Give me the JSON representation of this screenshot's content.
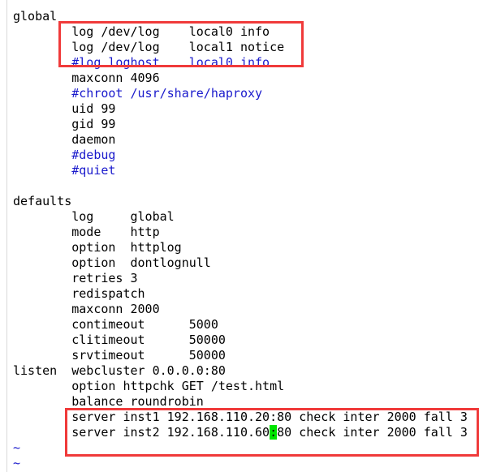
{
  "colors": {
    "comment": "#1a1acc",
    "highlight_box": "#f03a3a",
    "cursor": "#00e600"
  },
  "lines": [
    {
      "text": "global",
      "type": "normal"
    },
    {
      "text": "        log /dev/log    local0 info",
      "type": "normal"
    },
    {
      "text": "        log /dev/log    local1 notice",
      "type": "normal"
    },
    {
      "text": "        #log loghost    local0 info",
      "type": "comment"
    },
    {
      "text": "        maxconn 4096",
      "type": "normal"
    },
    {
      "text": "        #chroot /usr/share/haproxy",
      "type": "comment"
    },
    {
      "text": "        uid 99",
      "type": "normal"
    },
    {
      "text": "        gid 99",
      "type": "normal"
    },
    {
      "text": "        daemon",
      "type": "normal"
    },
    {
      "text": "        #debug",
      "type": "comment"
    },
    {
      "text": "        #quiet",
      "type": "comment"
    },
    {
      "text": "",
      "type": "normal"
    },
    {
      "text": "defaults",
      "type": "normal"
    },
    {
      "text": "        log     global",
      "type": "normal"
    },
    {
      "text": "        mode    http",
      "type": "normal"
    },
    {
      "text": "        option  httplog",
      "type": "normal"
    },
    {
      "text": "        option  dontlognull",
      "type": "normal"
    },
    {
      "text": "        retries 3",
      "type": "normal"
    },
    {
      "text": "        redispatch",
      "type": "normal"
    },
    {
      "text": "        maxconn 2000",
      "type": "normal"
    },
    {
      "text": "        contimeout      5000",
      "type": "normal"
    },
    {
      "text": "        clitimeout      50000",
      "type": "normal"
    },
    {
      "text": "        srvtimeout      50000",
      "type": "normal"
    },
    {
      "text": "listen  webcluster 0.0.0.0:80",
      "type": "normal"
    },
    {
      "text": "        option httpchk GET /test.html",
      "type": "normal"
    },
    {
      "text": "        balance roundrobin",
      "type": "normal"
    },
    {
      "text": "        server inst1 192.168.110.20:80 check inter 2000 fall 3",
      "type": "normal"
    },
    {
      "text": "        server inst2 192.168.110.60",
      "type": "cursorline",
      "cursor_char": ":",
      "after": "80 check inter 2000 fall 3"
    },
    {
      "text": "~",
      "type": "tilde"
    },
    {
      "text": "~",
      "type": "tilde"
    }
  ]
}
